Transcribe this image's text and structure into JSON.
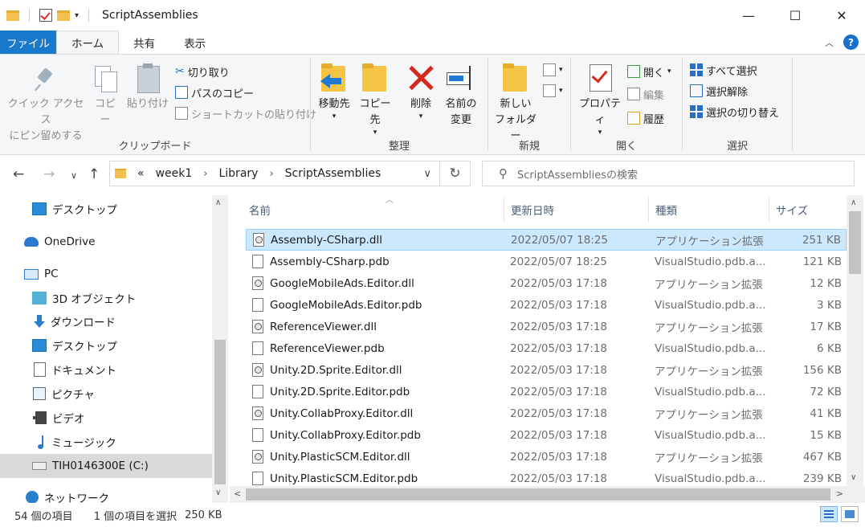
{
  "window": {
    "title": "ScriptAssemblies",
    "controls": {
      "minimize": "—",
      "maximize": "☐",
      "close": "✕"
    }
  },
  "ribbon_tabs": [
    "ファイル",
    "ホーム",
    "共有",
    "表示"
  ],
  "ribbon": {
    "clipboard": {
      "pin_label": [
        "クイック アクセス",
        "にピン留めする"
      ],
      "copy": "コピー",
      "paste": "貼り付け",
      "cut": "切り取り",
      "copy_path": "パスのコピー",
      "paste_shortcut": "ショートカットの貼り付け",
      "group": "クリップボード"
    },
    "organize": {
      "move_to": "移動先",
      "copy_to": "コピー先",
      "delete": "削除",
      "rename": [
        "名前の",
        "変更"
      ],
      "group": "整理"
    },
    "new": {
      "new_folder": [
        "新しい",
        "フォルダー"
      ],
      "group": "新規"
    },
    "open": {
      "properties": "プロパティ",
      "open": "開く",
      "edit": "編集",
      "history": "履歴",
      "group": "開く"
    },
    "select": {
      "select_all": "すべて選択",
      "select_none": "選択解除",
      "invert": "選択の切り替え",
      "group": "選択"
    }
  },
  "address": {
    "prefix": "«",
    "breadcrumb": [
      "week1",
      "Library",
      "ScriptAssemblies"
    ],
    "search_placeholder": "ScriptAssembliesの検索"
  },
  "nav_pane": [
    {
      "label": "デスクトップ",
      "icon": "desktop-icon"
    },
    {
      "label": "OneDrive",
      "icon": "onedrive-icon"
    },
    {
      "label": "PC",
      "icon": "pc-icon"
    },
    {
      "label": "3D オブジェクト",
      "icon": "3d-objects-icon"
    },
    {
      "label": "ダウンロード",
      "icon": "download-icon"
    },
    {
      "label": "デスクトップ",
      "icon": "desktop-icon"
    },
    {
      "label": "ドキュメント",
      "icon": "documents-icon"
    },
    {
      "label": "ピクチャ",
      "icon": "pictures-icon"
    },
    {
      "label": "ビデオ",
      "icon": "videos-icon"
    },
    {
      "label": "ミュージック",
      "icon": "music-icon"
    },
    {
      "label": "TIH0146300E (C:)",
      "icon": "drive-icon"
    },
    {
      "label": "ネットワーク",
      "icon": "network-icon"
    }
  ],
  "columns": {
    "name": "名前",
    "date": "更新日時",
    "type": "種類",
    "size": "サイズ"
  },
  "files": [
    {
      "name": "Assembly-CSharp.dll",
      "date": "2022/05/07 18:25",
      "type": "アプリケーション拡張",
      "size": "251 KB"
    },
    {
      "name": "Assembly-CSharp.pdb",
      "date": "2022/05/07 18:25",
      "type": "VisualStudio.pdb.a...",
      "size": "121 KB"
    },
    {
      "name": "GoogleMobileAds.Editor.dll",
      "date": "2022/05/03 17:18",
      "type": "アプリケーション拡張",
      "size": "12 KB"
    },
    {
      "name": "GoogleMobileAds.Editor.pdb",
      "date": "2022/05/03 17:18",
      "type": "VisualStudio.pdb.a...",
      "size": "3 KB"
    },
    {
      "name": "ReferenceViewer.dll",
      "date": "2022/05/03 17:18",
      "type": "アプリケーション拡張",
      "size": "17 KB"
    },
    {
      "name": "ReferenceViewer.pdb",
      "date": "2022/05/03 17:18",
      "type": "VisualStudio.pdb.a...",
      "size": "6 KB"
    },
    {
      "name": "Unity.2D.Sprite.Editor.dll",
      "date": "2022/05/03 17:18",
      "type": "アプリケーション拡張",
      "size": "156 KB"
    },
    {
      "name": "Unity.2D.Sprite.Editor.pdb",
      "date": "2022/05/03 17:18",
      "type": "VisualStudio.pdb.a...",
      "size": "72 KB"
    },
    {
      "name": "Unity.CollabProxy.Editor.dll",
      "date": "2022/05/03 17:18",
      "type": "アプリケーション拡張",
      "size": "41 KB"
    },
    {
      "name": "Unity.CollabProxy.Editor.pdb",
      "date": "2022/05/03 17:18",
      "type": "VisualStudio.pdb.a...",
      "size": "15 KB"
    },
    {
      "name": "Unity.PlasticSCM.Editor.dll",
      "date": "2022/05/03 17:18",
      "type": "アプリケーション拡張",
      "size": "467 KB"
    },
    {
      "name": "Unity.PlasticSCM.Editor.pdb",
      "date": "2022/05/03 17:18",
      "type": "VisualStudio.pdb.a...",
      "size": "239 KB"
    }
  ],
  "status": {
    "count": "54 個の項目",
    "selected": "1 個の項目を選択",
    "size": "250 KB"
  }
}
